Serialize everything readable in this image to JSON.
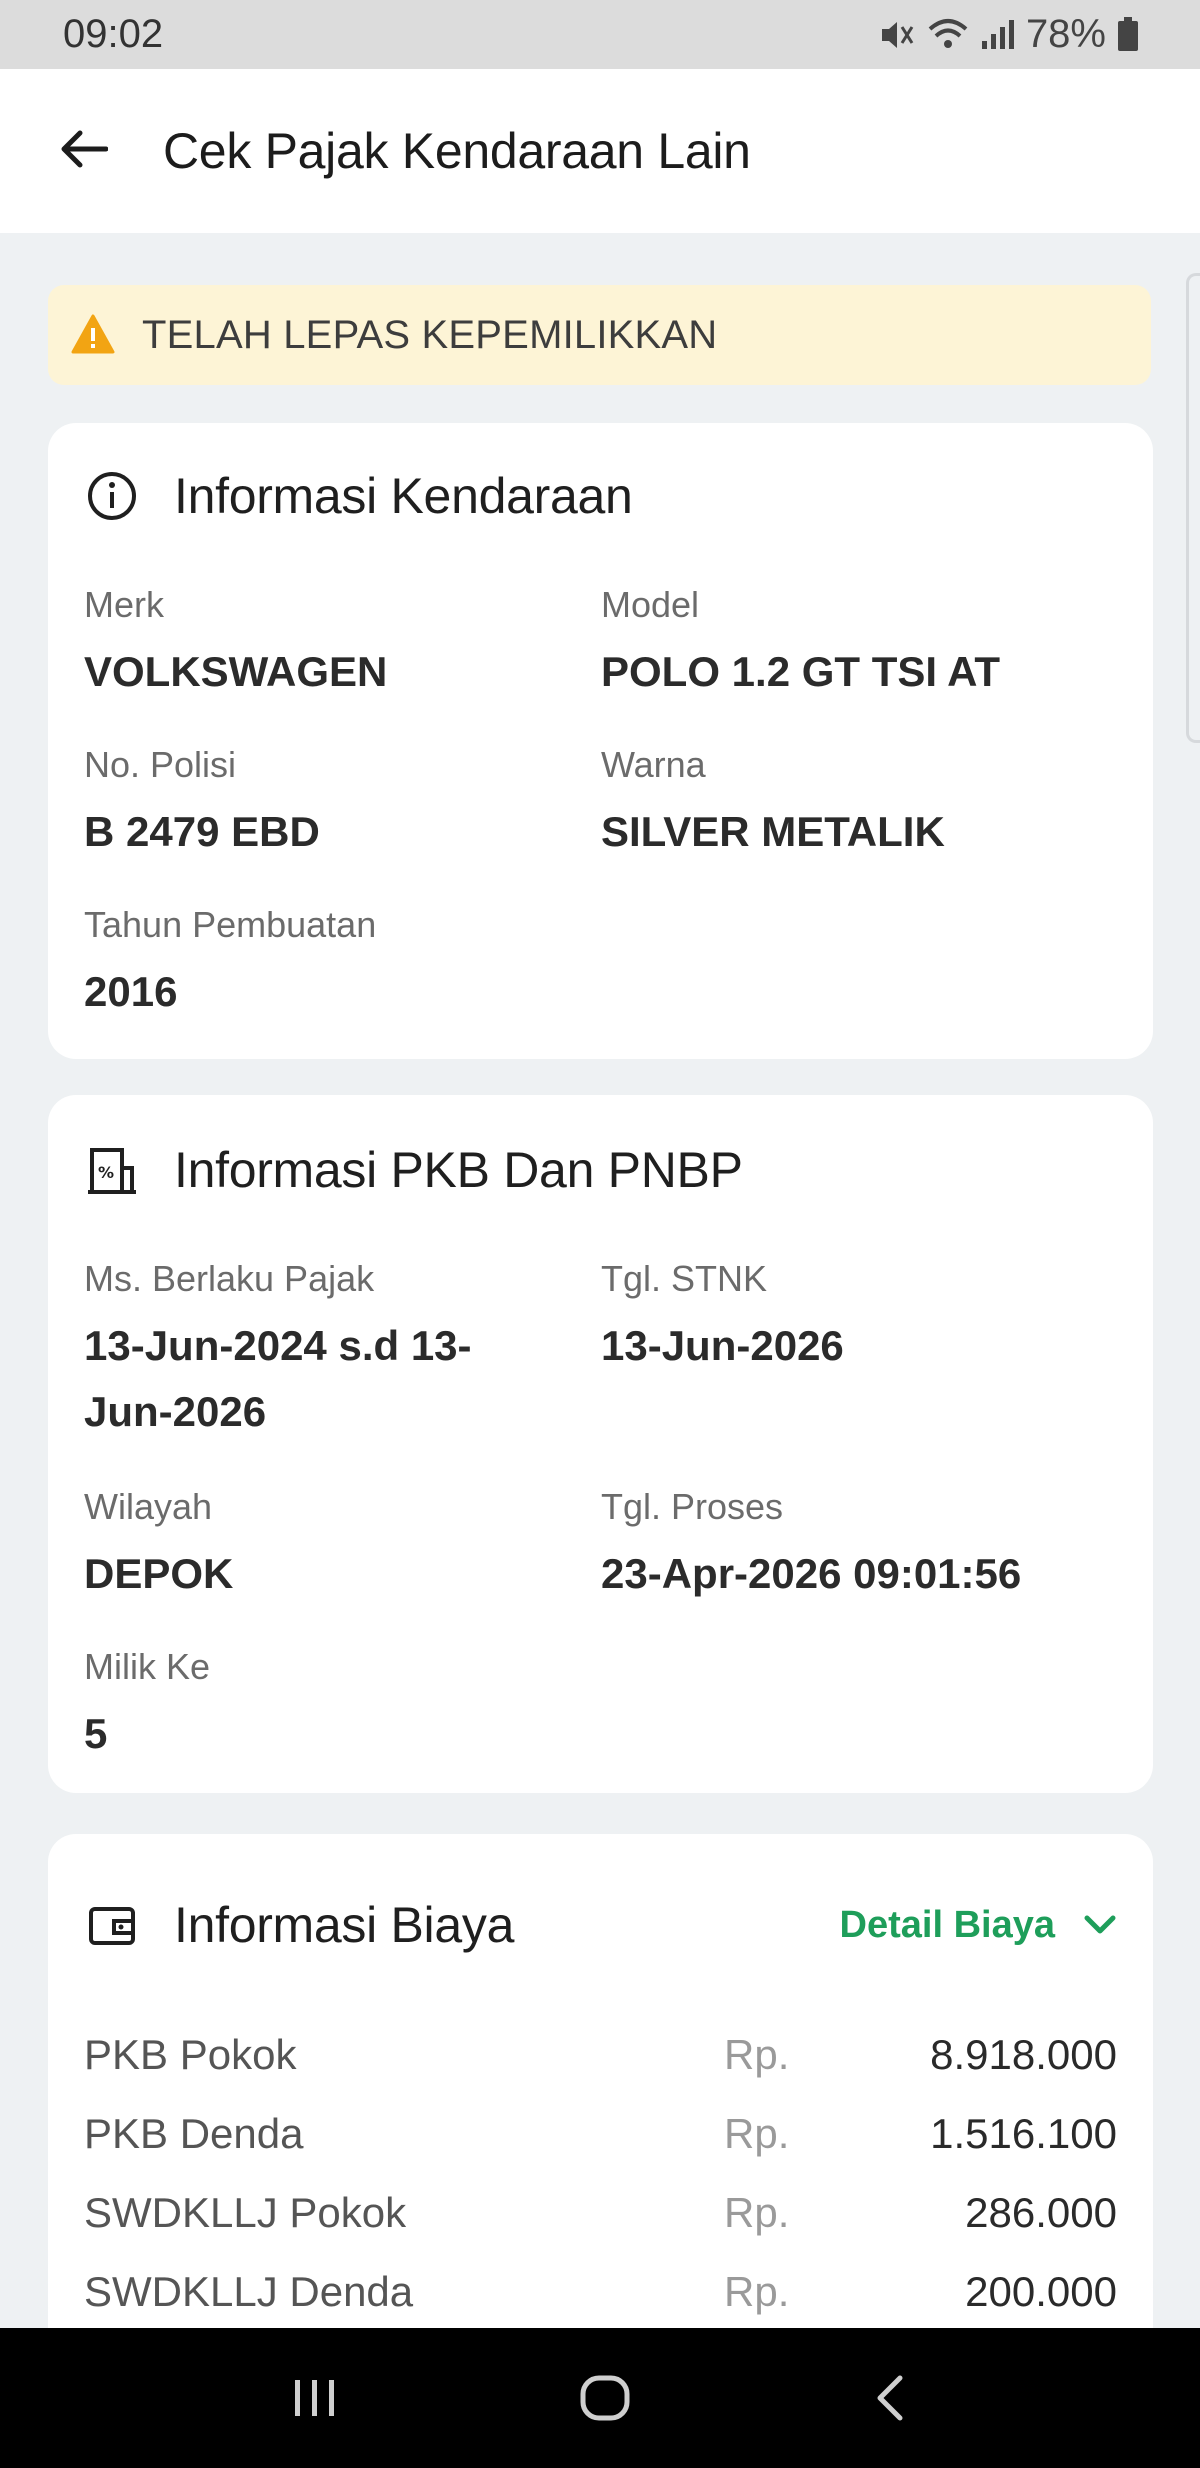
{
  "status_bar": {
    "time": "09:02",
    "battery": "78%",
    "icons": [
      "mute-icon",
      "wifi-icon",
      "signal-icon",
      "battery-icon"
    ]
  },
  "app_bar": {
    "title": "Cek Pajak Kendaraan Lain",
    "back_icon": "arrow-left-icon"
  },
  "warning": {
    "text": "TELAH LEPAS KEPEMILIKKAN",
    "icon": "warning-icon",
    "color": "#f2a413"
  },
  "vehicle_info": {
    "title": "Informasi Kendaraan",
    "icon": "info-icon",
    "fields": {
      "merk": {
        "label": "Merk",
        "value": "VOLKSWAGEN"
      },
      "model": {
        "label": "Model",
        "value": "POLO 1.2 GT TSI AT"
      },
      "no_polisi": {
        "label": "No. Polisi",
        "value": "B 2479 EBD"
      },
      "warna": {
        "label": "Warna",
        "value": "SILVER METALIK"
      },
      "tahun": {
        "label": "Tahun Pembuatan",
        "value": "2016"
      }
    }
  },
  "pkb_info": {
    "title": "Informasi PKB Dan PNBP",
    "icon": "tax-building-icon",
    "fields": {
      "masa_berlaku": {
        "label": "Ms. Berlaku Pajak",
        "value_line1": "13-Jun-2024 s.d 13-",
        "value_line2": "Jun-2026"
      },
      "tgl_stnk": {
        "label": "Tgl. STNK",
        "value": "13-Jun-2026"
      },
      "wilayah": {
        "label": "Wilayah",
        "value": "DEPOK"
      },
      "tgl_proses": {
        "label": "Tgl. Proses",
        "value": "23-Apr-2026 09:01:56"
      },
      "milik_ke": {
        "label": "Milik Ke",
        "value": "5"
      }
    }
  },
  "biaya_info": {
    "title": "Informasi Biaya",
    "icon": "wallet-icon",
    "detail_link": "Detail Biaya",
    "detail_color": "#1e9e5a",
    "rows": [
      {
        "name": "PKB Pokok",
        "currency": "Rp.",
        "amount": "8.918.000"
      },
      {
        "name": "PKB Denda",
        "currency": "Rp.",
        "amount": "1.516.100"
      },
      {
        "name": "SWDKLLJ Pokok",
        "currency": "Rp.",
        "amount": "286.000"
      },
      {
        "name": "SWDKLLJ Denda",
        "currency": "Rp.",
        "amount": "200.000"
      }
    ]
  },
  "nav_bar": {
    "icons": [
      "recent-apps-icon",
      "home-icon",
      "back-nav-icon"
    ]
  }
}
